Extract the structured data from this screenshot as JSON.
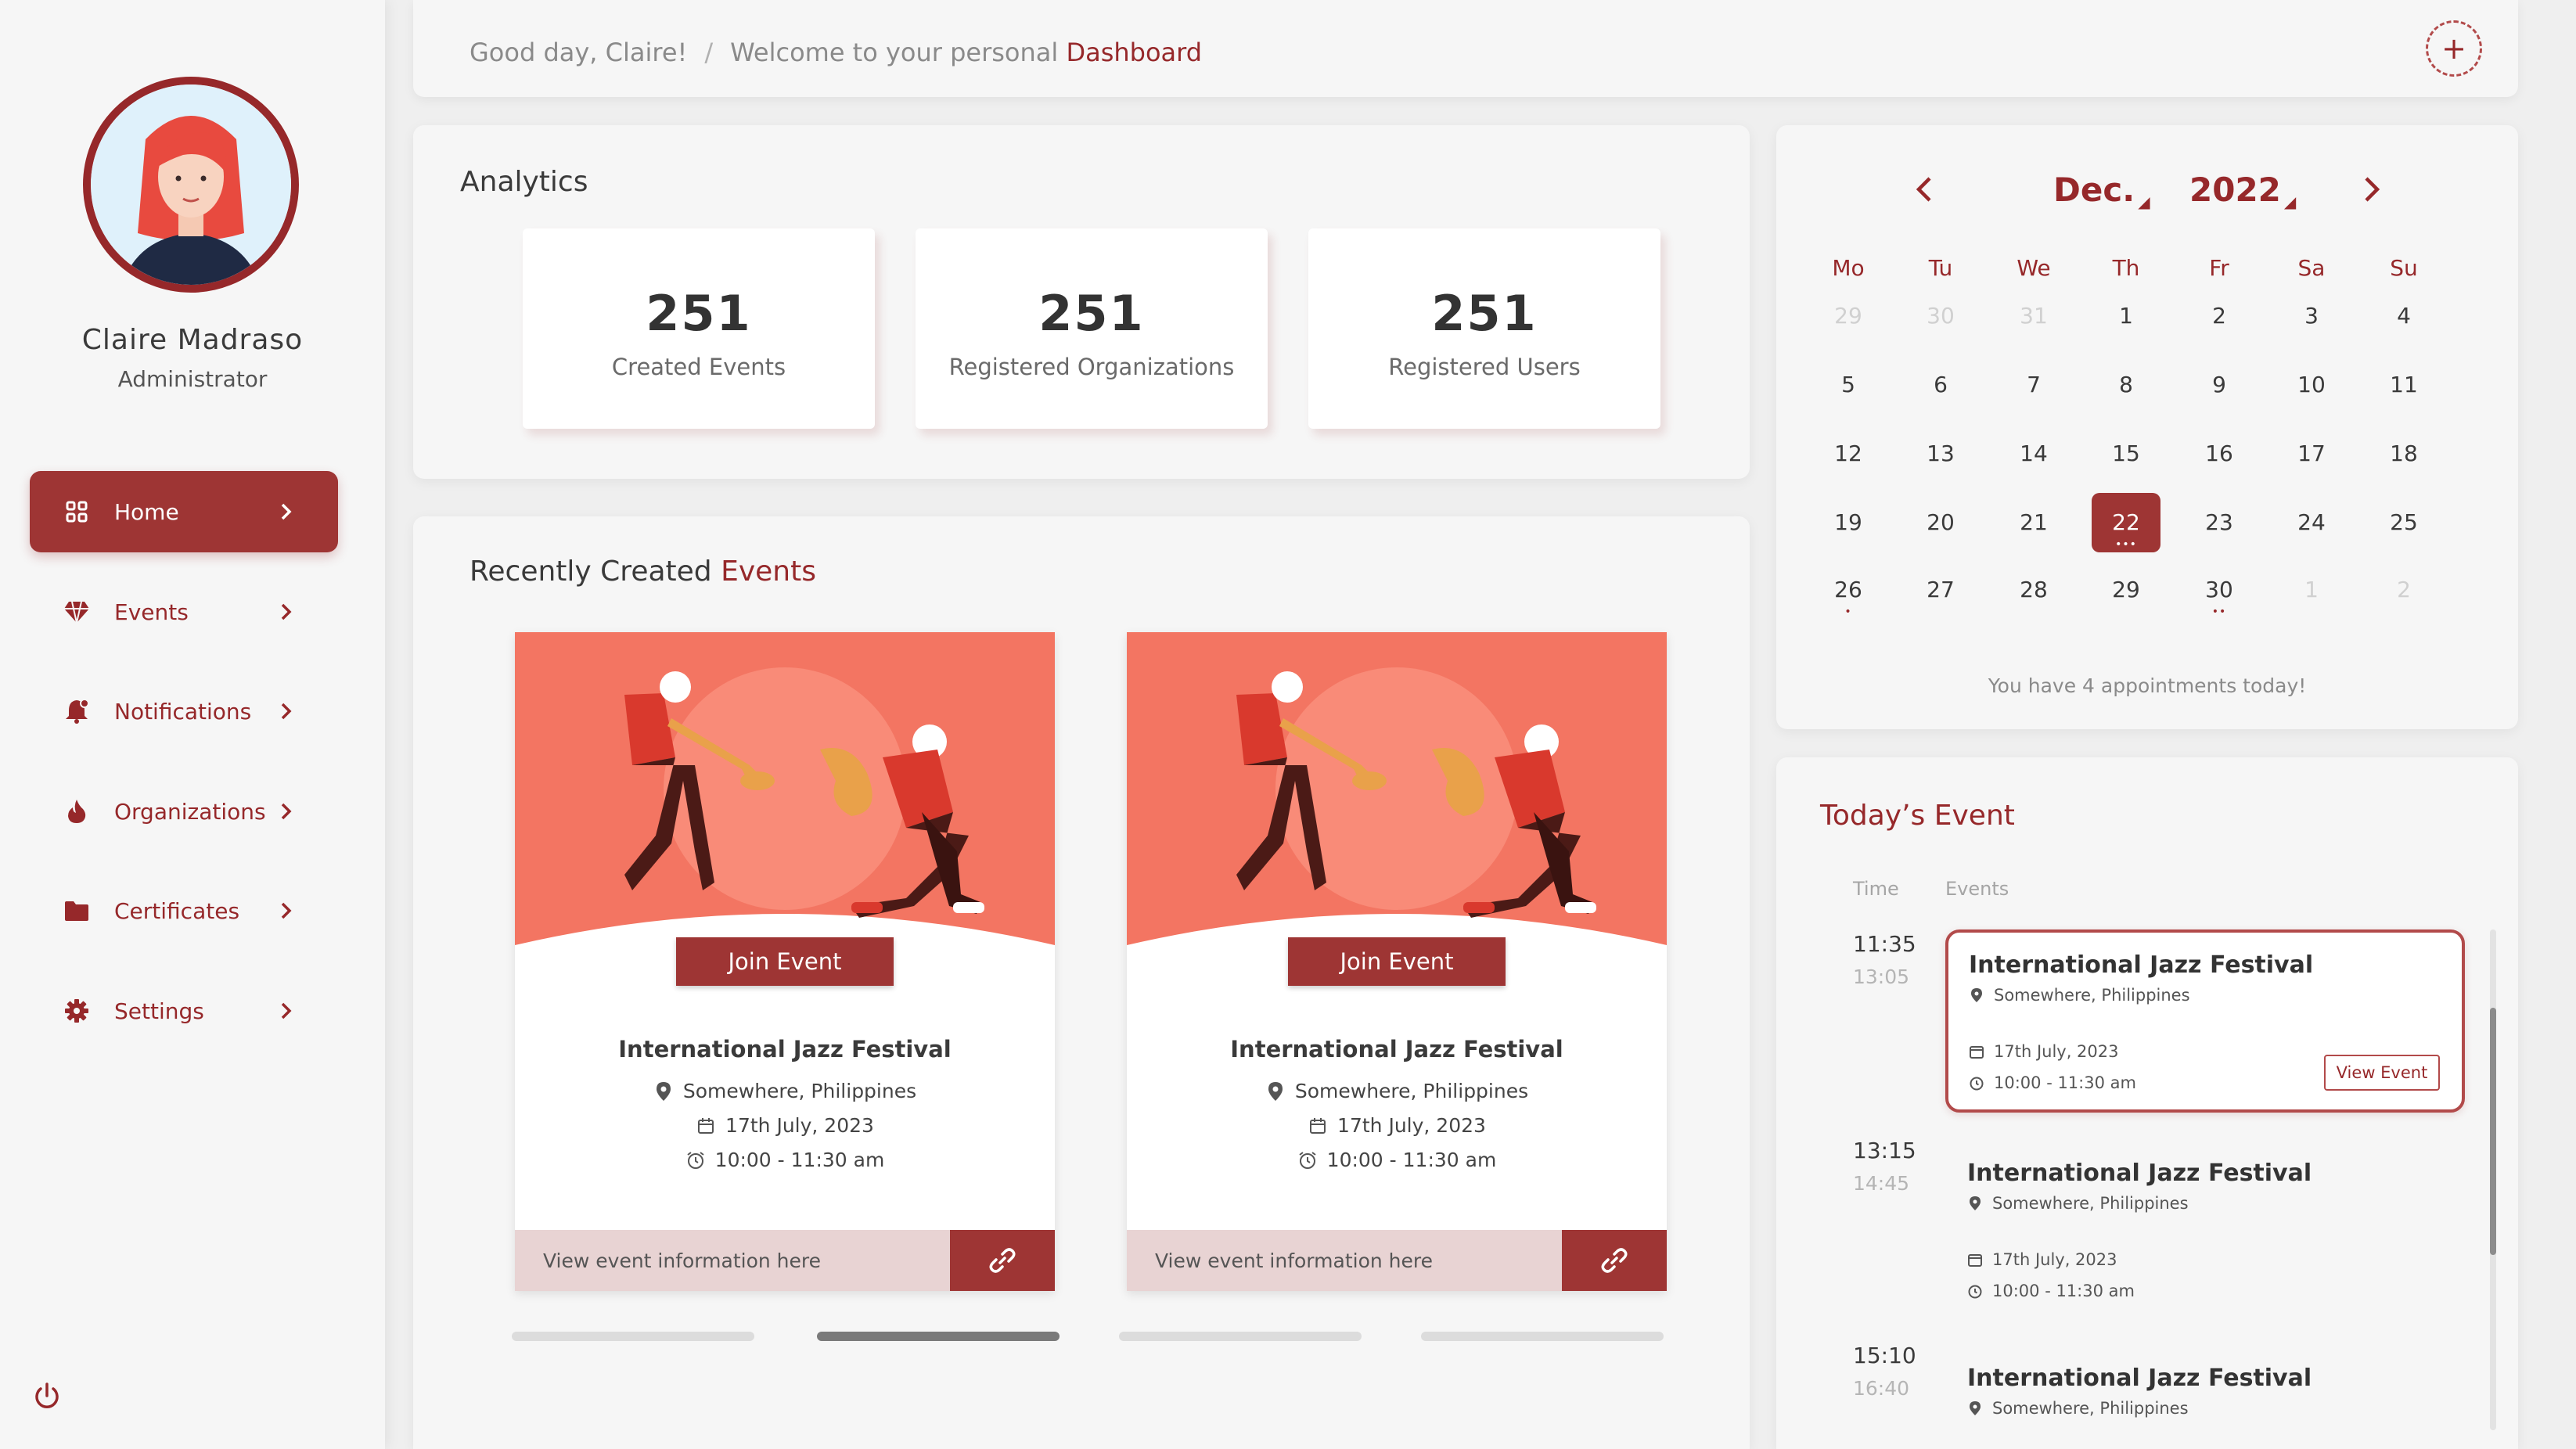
{
  "user": {
    "name": "Claire Madraso",
    "role": "Administrator"
  },
  "nav": [
    {
      "label": "Home",
      "icon": "grid-icon",
      "active": true
    },
    {
      "label": "Events",
      "icon": "diamond-icon"
    },
    {
      "label": "Notifications",
      "icon": "bell-icon"
    },
    {
      "label": "Organizations",
      "icon": "fire-icon"
    },
    {
      "label": "Certificates",
      "icon": "folder-icon"
    },
    {
      "label": "Settings",
      "icon": "gear-icon"
    }
  ],
  "header": {
    "greeting": "Good day, Claire!",
    "separator": "/",
    "welcome_prefix": "Welcome to your personal ",
    "welcome_highlight": "Dashboard",
    "add_symbol": "+"
  },
  "analytics": {
    "title": "Analytics",
    "stats": [
      {
        "value": "251",
        "label": "Created Events"
      },
      {
        "value": "251",
        "label": "Registered Organizations"
      },
      {
        "value": "251",
        "label": "Registered Users"
      }
    ]
  },
  "recent": {
    "title_prefix": "Recently Created ",
    "title_highlight": "Events",
    "cards": [
      {
        "join_label": "Join Event",
        "name": "International Jazz Festival",
        "location": "Somewhere, Philippines",
        "date": "17th July, 2023",
        "time": "10:00 - 11:30 am",
        "footer_text": "View event information here"
      },
      {
        "join_label": "Join Event",
        "name": "International Jazz Festival",
        "location": "Somewhere, Philippines",
        "date": "17th July, 2023",
        "time": "10:00 - 11:30 am",
        "footer_text": "View event information here"
      }
    ],
    "carousel_pages": 4,
    "carousel_active": 2
  },
  "calendar": {
    "month": "Dec.",
    "year": "2022",
    "weekdays": [
      "Mo",
      "Tu",
      "We",
      "Th",
      "Fr",
      "Sa",
      "Su"
    ],
    "weeks": [
      [
        {
          "d": "29",
          "m": true
        },
        {
          "d": "30",
          "m": true
        },
        {
          "d": "31",
          "m": true
        },
        {
          "d": "1"
        },
        {
          "d": "2"
        },
        {
          "d": "3"
        },
        {
          "d": "4"
        }
      ],
      [
        {
          "d": "5"
        },
        {
          "d": "6"
        },
        {
          "d": "7"
        },
        {
          "d": "8"
        },
        {
          "d": "9"
        },
        {
          "d": "10"
        },
        {
          "d": "11"
        }
      ],
      [
        {
          "d": "12"
        },
        {
          "d": "13"
        },
        {
          "d": "14"
        },
        {
          "d": "15"
        },
        {
          "d": "16"
        },
        {
          "d": "17"
        },
        {
          "d": "18"
        }
      ],
      [
        {
          "d": "19"
        },
        {
          "d": "20"
        },
        {
          "d": "21"
        },
        {
          "d": "22",
          "today": true,
          "dots": 3
        },
        {
          "d": "23"
        },
        {
          "d": "24"
        },
        {
          "d": "25"
        }
      ],
      [
        {
          "d": "26",
          "dots": 1
        },
        {
          "d": "27"
        },
        {
          "d": "28"
        },
        {
          "d": "29"
        },
        {
          "d": "30",
          "dots": 2
        },
        {
          "d": "1",
          "m": true
        },
        {
          "d": "2",
          "m": true
        }
      ]
    ],
    "note": "You have 4 appointments today!"
  },
  "today": {
    "title": "Today’s Event",
    "col_time": "Time",
    "col_events": "Events",
    "view_label": "View Event",
    "items": [
      {
        "start": "11:35",
        "end": "13:05",
        "name": "International Jazz Festival",
        "location": "Somewhere, Philippines",
        "date": "17th July, 2023",
        "time": "10:00 - 11:30 am"
      },
      {
        "start": "13:15",
        "end": "14:45",
        "name": "International Jazz Festival",
        "location": "Somewhere, Philippines",
        "date": "17th July, 2023",
        "time": "10:00 - 11:30 am"
      },
      {
        "start": "15:10",
        "end": "16:40",
        "name": "International Jazz Festival",
        "location": "Somewhere, Philippines"
      }
    ]
  },
  "colors": {
    "accent": "#96282a",
    "accent_button": "#9e3534",
    "card_illustration": "#f37562",
    "footer_bg": "#e8d3d3"
  }
}
